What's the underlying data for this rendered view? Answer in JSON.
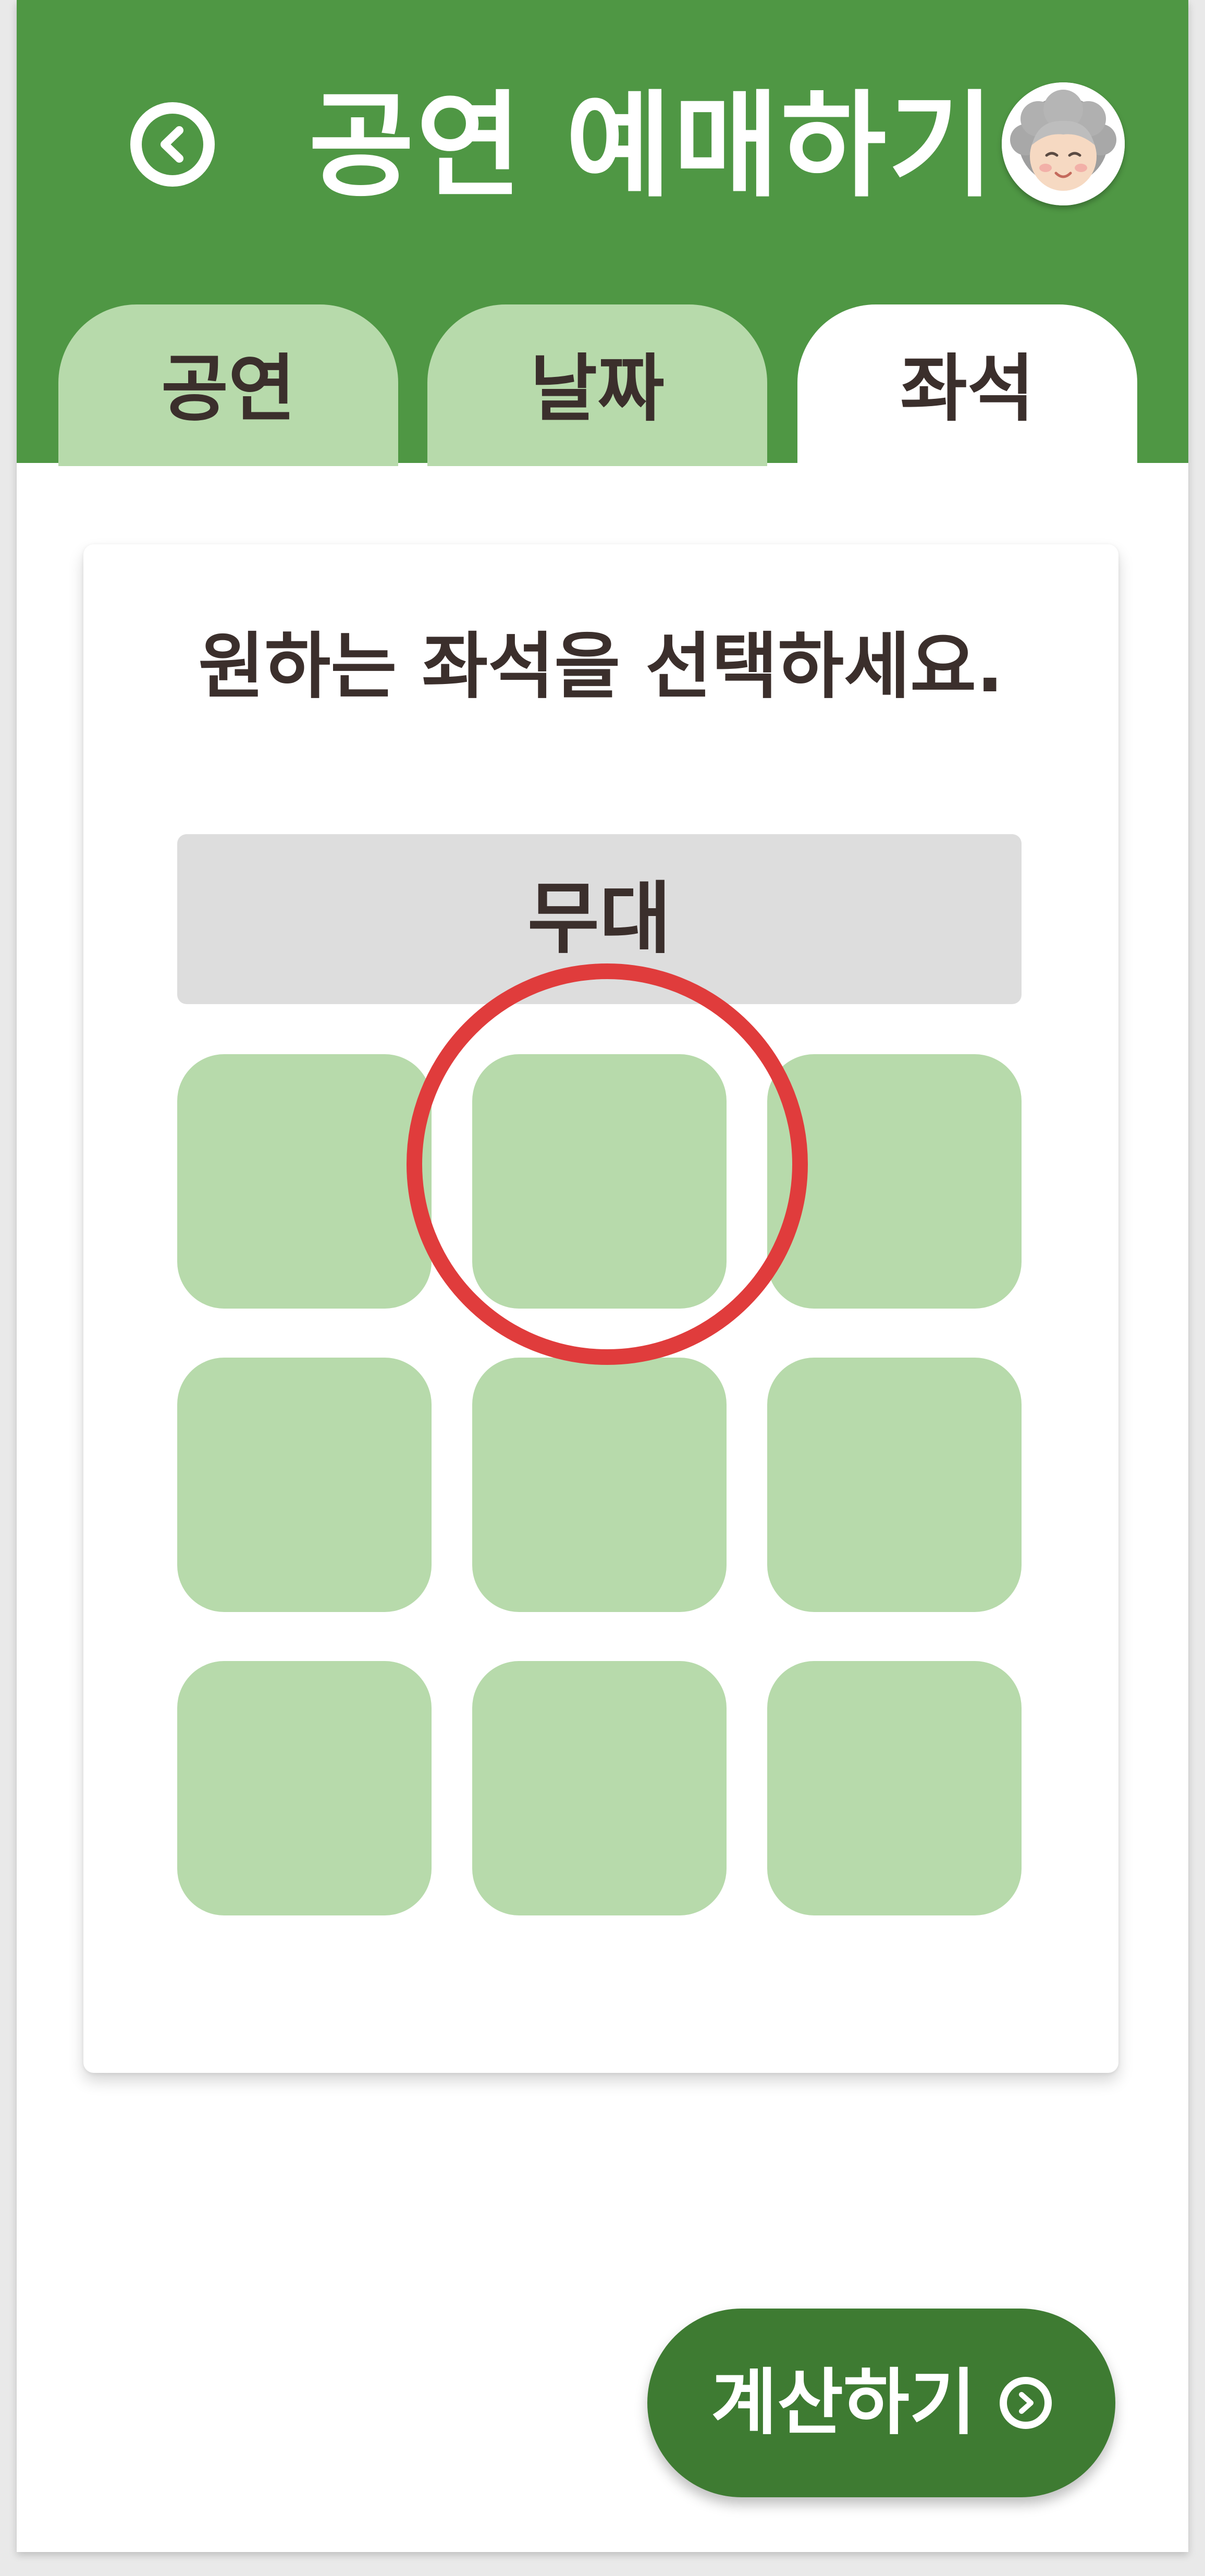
{
  "header": {
    "title": "공연 예매하기",
    "back_icon": "chevron-left-circle-icon",
    "avatar_icon": "grandmother-avatar",
    "background_color": "#4f9744"
  },
  "tabs": [
    {
      "label": "공연",
      "active": false
    },
    {
      "label": "날짜",
      "active": false
    },
    {
      "label": "좌석",
      "active": true
    }
  ],
  "main": {
    "instruction": "원하는 좌석을 선택하세요.",
    "stage_label": "무대",
    "seat_rows": 3,
    "seat_columns": 3,
    "highlighted_seat": {
      "row": 1,
      "column": 2
    },
    "seat_color": "#b7daab",
    "highlight_color": "#e03c3c"
  },
  "footer": {
    "calculate_label": "계산하기",
    "calculate_icon": "chevron-right-circle-icon",
    "button_color": "#3e7b32"
  }
}
